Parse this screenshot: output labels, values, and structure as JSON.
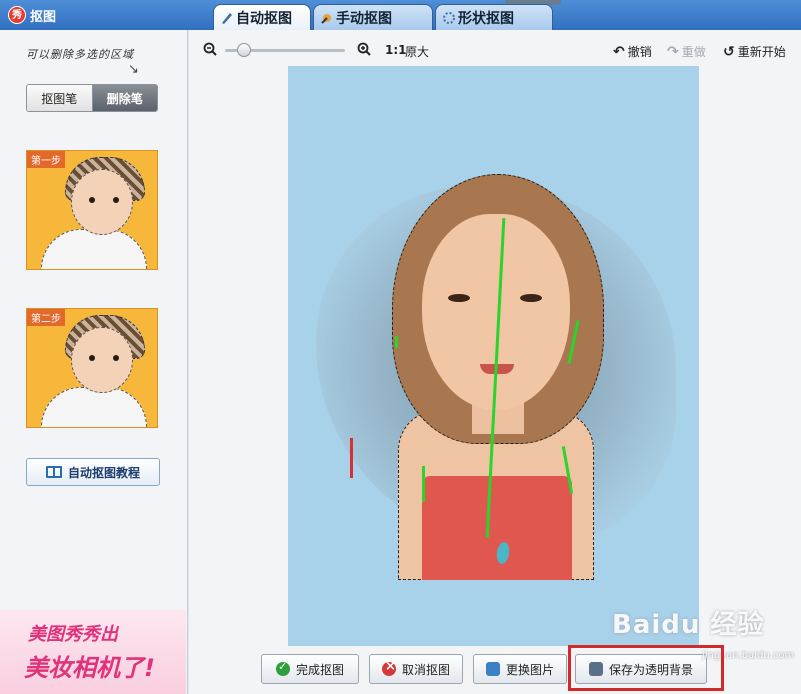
{
  "window": {
    "title": "抠图"
  },
  "tabs": [
    {
      "label": "自动抠图",
      "active": true
    },
    {
      "label": "手动抠图",
      "active": false
    },
    {
      "label": "形状抠图",
      "active": false
    }
  ],
  "left": {
    "hint": "可以删除多选的区域",
    "pens": {
      "cutout": "抠图笔",
      "erase": "删除笔"
    },
    "step1": "第一步",
    "step2": "第二步",
    "tutorial": "自动抠图教程",
    "promo": {
      "line1": "美图秀秀出",
      "line2": "美妆相机了!"
    }
  },
  "toolbar": {
    "ratio": "1:1",
    "original": "原大",
    "undo": "撤销",
    "redo": "重做",
    "reset": "重新开始"
  },
  "bottom": {
    "done": "完成抠图",
    "cancel": "取消抠图",
    "change": "更换图片",
    "save": "保存为透明背景"
  },
  "watermark": {
    "brand": "Baidu 经验",
    "sub": "jingyan.baidu.com"
  },
  "colors": {
    "accent": "#2f6fc0",
    "highlight": "#d22a2a",
    "canvas_bg": "#a8d1ea"
  }
}
